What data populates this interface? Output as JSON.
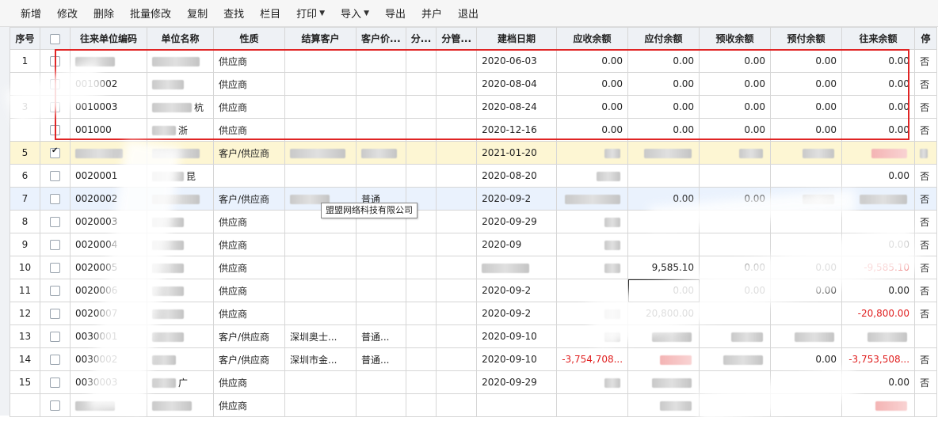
{
  "toolbar": {
    "buttons": [
      {
        "label": "新增"
      },
      {
        "label": "修改"
      },
      {
        "label": "删除"
      },
      {
        "label": "批量修改"
      },
      {
        "label": "复制"
      },
      {
        "label": "查找"
      },
      {
        "label": "栏目"
      },
      {
        "label": "打印",
        "dropdown": true
      },
      {
        "label": "导入",
        "dropdown": true
      },
      {
        "label": "导出"
      },
      {
        "label": "并户"
      },
      {
        "label": "退出"
      }
    ]
  },
  "table": {
    "headers": [
      "序号",
      "",
      "往来单位编码",
      "单位名称",
      "性质",
      "结算客户",
      "客户价...",
      "分...",
      "分管...",
      "建档日期",
      "应收余额",
      "应付余额",
      "预收余额",
      "预付余额",
      "往来余额",
      "停"
    ],
    "rows": [
      {
        "no": "1",
        "checked": false,
        "code": "",
        "name": "",
        "type": "供应商",
        "settle": "",
        "price": "",
        "f1": "",
        "f2": "",
        "date": "2020-06-03",
        "ar": "0.00",
        "ap": "0.00",
        "adv_r": "0.00",
        "adv_p": "0.00",
        "bal": "0.00",
        "stop": "否"
      },
      {
        "no": "",
        "checked": false,
        "code": "0010002",
        "name": "",
        "type": "供应商",
        "settle": "",
        "price": "",
        "f1": "",
        "f2": "",
        "date": "2020-08-04",
        "ar": "0.00",
        "ap": "0.00",
        "adv_r": "0.00",
        "adv_p": "0.00",
        "bal": "0.00",
        "stop": "否"
      },
      {
        "no": "3",
        "checked": false,
        "code": "0010003",
        "name": "杭",
        "type": "供应商",
        "settle": "",
        "price": "",
        "f1": "",
        "f2": "",
        "date": "2020-08-24",
        "ar": "0.00",
        "ap": "0.00",
        "adv_r": "0.00",
        "adv_p": "0.00",
        "bal": "0.00",
        "stop": "否"
      },
      {
        "no": "",
        "checked": false,
        "code": "001000",
        "name": "浙",
        "type": "供应商",
        "settle": "",
        "price": "",
        "f1": "",
        "f2": "",
        "date": "2020-12-16",
        "ar": "0.00",
        "ap": "0.00",
        "adv_r": "0.00",
        "adv_p": "0.00",
        "bal": "0.00",
        "stop": "否"
      },
      {
        "no": "5",
        "checked": true,
        "code": "",
        "name": "",
        "type": "客户/供应商",
        "settle": "",
        "price": "",
        "f1": "",
        "f2": "",
        "date": "2021-01-20",
        "ar": "",
        "ap": "",
        "adv_r": "",
        "adv_p": "",
        "bal": "",
        "stop": ""
      },
      {
        "no": "6",
        "checked": false,
        "code": "0020001",
        "name": "昆",
        "type": "",
        "settle": "",
        "price": "",
        "f1": "",
        "f2": "",
        "date": "2020-08-20",
        "ar": "",
        "ap": "",
        "adv_r": "",
        "adv_p": "",
        "bal": "0.00",
        "stop": "否"
      },
      {
        "no": "7",
        "checked": false,
        "code": "0020002",
        "name": "",
        "type": "客户/供应商",
        "settle": "",
        "price": "普通",
        "f1": "",
        "f2": "",
        "date": "2020-09-2",
        "ar": "",
        "ap": "0.00",
        "adv_r": "0.00",
        "adv_p": "",
        "bal": "",
        "stop": "否"
      },
      {
        "no": "8",
        "checked": false,
        "code": "0020003",
        "name": "",
        "type": "供应商",
        "settle": "",
        "price": "",
        "f1": "",
        "f2": "",
        "date": "2020-09-29",
        "ar": "",
        "ap": "",
        "adv_r": "",
        "adv_p": "",
        "bal": "",
        "stop": "否"
      },
      {
        "no": "9",
        "checked": false,
        "code": "0020004",
        "name": "",
        "type": "供应商",
        "settle": "",
        "price": "",
        "f1": "",
        "f2": "",
        "date": "2020-09",
        "ar": "",
        "ap": "",
        "adv_r": "",
        "adv_p": "",
        "bal": "0.00",
        "stop": "否"
      },
      {
        "no": "10",
        "checked": false,
        "code": "0020005",
        "name": "",
        "type": "供应商",
        "settle": "",
        "price": "",
        "f1": "",
        "f2": "",
        "date": "",
        "ar": "",
        "ap": "9,585.10",
        "adv_r": "0.00",
        "adv_p": "0.00",
        "bal": "-9,585.10",
        "stop": "否"
      },
      {
        "no": "11",
        "checked": false,
        "code": "0020006",
        "name": "",
        "type": "供应商",
        "settle": "",
        "price": "",
        "f1": "",
        "f2": "",
        "date": "2020-09-2",
        "ar": "",
        "ap": "0.00",
        "adv_r": "0.00",
        "adv_p": "0.00",
        "bal": "0.00",
        "stop": "否"
      },
      {
        "no": "12",
        "checked": false,
        "code": "0020007",
        "name": "",
        "type": "供应商",
        "settle": "",
        "price": "",
        "f1": "",
        "f2": "",
        "date": "2020-09-2",
        "ar": "",
        "ap": "20,800.00",
        "adv_r": "",
        "adv_p": "",
        "bal": "-20,800.00",
        "stop": "否"
      },
      {
        "no": "13",
        "checked": false,
        "code": "0030001",
        "name": "",
        "type": "客户/供应商",
        "settle": "深圳奥士...",
        "price": "普通...",
        "f1": "",
        "f2": "",
        "date": "2020-09-10",
        "ar": "",
        "ap": "",
        "adv_r": "",
        "adv_p": "",
        "bal": "",
        "stop": ""
      },
      {
        "no": "14",
        "checked": false,
        "code": "0030002",
        "name": "",
        "type": "客户/供应商",
        "settle": "深圳市金...",
        "price": "普通...",
        "f1": "",
        "f2": "",
        "date": "2020-09-10",
        "ar": "-3,754,708...",
        "ap": "",
        "adv_r": "",
        "adv_p": "0.00",
        "bal": "-3,753,508...",
        "stop": "否"
      },
      {
        "no": "15",
        "checked": false,
        "code": "0030003",
        "name": "广",
        "type": "供应商",
        "settle": "",
        "price": "",
        "f1": "",
        "f2": "",
        "date": "2020-09-29",
        "ar": "",
        "ap": "",
        "adv_r": "",
        "adv_p": "",
        "bal": "0.00",
        "stop": "否"
      },
      {
        "no": "",
        "checked": false,
        "code": "",
        "name": "",
        "type": "供应商",
        "settle": "",
        "price": "",
        "f1": "",
        "f2": "",
        "date": "",
        "ar": "",
        "ap": "",
        "adv_r": "",
        "adv_p": "",
        "bal": "",
        "stop": ""
      }
    ]
  },
  "tooltip": {
    "text": "盟盟网络科技有限公司"
  },
  "colors": {
    "highlight": "#e02424",
    "negative": "#e02020",
    "selected_row": "#fdf6d3",
    "header_bg": "#eef1f5"
  }
}
